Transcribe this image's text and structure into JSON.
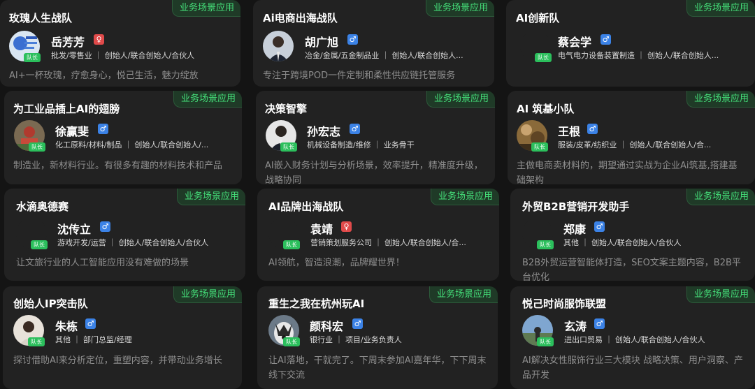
{
  "tag_label": "业务场景应用",
  "badge_label": "队长",
  "cards": [
    {
      "team": "玫瑰人生战队",
      "leader": "岳芳芳",
      "gender": "female",
      "gender_icon": "♀",
      "meta": "批发/零售业 ｜ 创始人/联合创始人/合伙人",
      "desc": "AI+一杯玫瑰，疗愈身心，悦己生活，魅力绽放"
    },
    {
      "team": "Ai电商出海战队",
      "leader": "胡广旭",
      "gender": "male",
      "gender_icon": "♂",
      "meta": "冶金/金属/五金制品业 ｜ 创始人/联合创始人...",
      "desc": "专注于跨境POD一件定制和柔性供应链托管服务"
    },
    {
      "team": "AI创新队",
      "leader": "蔡会学",
      "gender": "male",
      "gender_icon": "♂",
      "meta": "电气电力设备装置制造 ｜ 创始人/联合创始人...",
      "desc": ""
    },
    {
      "team": "为工业品插上AI的翅膀",
      "leader": "徐赢斐",
      "gender": "male",
      "gender_icon": "♂",
      "meta": "化工原料/材料/制品 ｜ 创始人/联合创始人/...",
      "desc": "制造业，新材料行业。有很多有趣的材料技术和产品"
    },
    {
      "team": "决策智擎",
      "leader": "孙宏志",
      "gender": "male",
      "gender_icon": "♂",
      "meta": "机械设备制造/维修 ｜ 业务骨干",
      "desc": "AI嵌入财务计划与分析场景，效率提升，精准度升级，战略协同"
    },
    {
      "team": "AI 筑基小队",
      "leader": "王根",
      "gender": "male",
      "gender_icon": "♂",
      "meta": "服装/皮革/纺织业 ｜ 创始人/联合创始人/合...",
      "desc": "主做电商卖材料的，期望通过实战为企业Ai筑基,搭建基础架构"
    },
    {
      "team": "水滴奥德赛",
      "leader": "沈传立",
      "gender": "male",
      "gender_icon": "♂",
      "meta": "游戏开发/运营 ｜ 创始人/联合创始人/合伙人",
      "desc": "让文旅行业的人工智能应用没有难做的场景"
    },
    {
      "team": "AI品牌出海战队",
      "leader": "袁靖",
      "gender": "female",
      "gender_icon": "♀",
      "meta": "营销策划服务公司 ｜ 创始人/联合创始人/合...",
      "desc": "AI领航，智造浪潮，品牌耀世界！"
    },
    {
      "team": "外贸B2B营销开发助手",
      "leader": "郑康",
      "gender": "male",
      "gender_icon": "♂",
      "meta": "其他 ｜ 创始人/联合创始人/合伙人",
      "desc": "B2B外贸运营智能体打造，SEO文案主题内容，B2B平台优化"
    },
    {
      "team": "创始人IP突击队",
      "leader": "朱栋",
      "gender": "male",
      "gender_icon": "♂",
      "meta": "其他 ｜ 部门总监/经理",
      "desc": "探讨借助AI来分析定位，重塑内容，并带动业务增长"
    },
    {
      "team": "重生之我在杭州玩AI",
      "leader": "颜科宏",
      "gender": "male",
      "gender_icon": "♂",
      "meta": "银行业 ｜ 项目/业务负责人",
      "desc": "让AI落地，干就完了。下周末参加AI嘉年华，下下周末线下交流"
    },
    {
      "team": "悦己时尚服饰联盟",
      "leader": "玄涛",
      "gender": "male",
      "gender_icon": "♂",
      "meta": "进出口贸易 ｜ 创始人/联合创始人/合伙人",
      "desc": "AI解决女性服饰行业三大模块 战略决策、用户洞察、产品开发"
    }
  ]
}
